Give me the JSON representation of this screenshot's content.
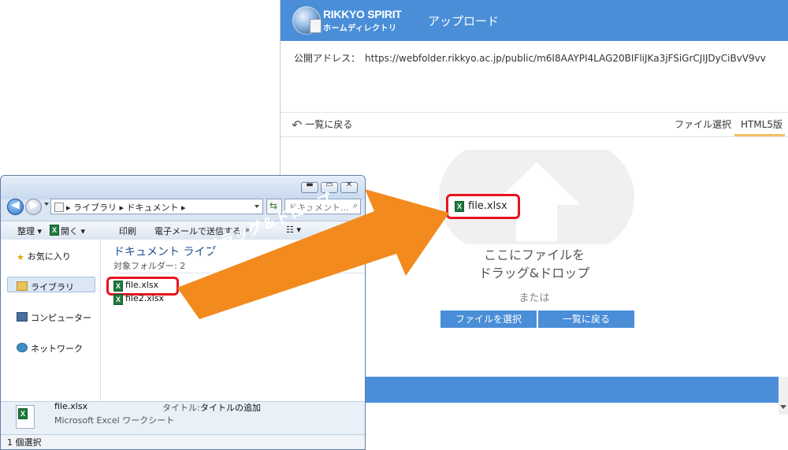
{
  "browser": {
    "logo_title": "RIKKYO SPIRIT",
    "logo_subtitle": "ホームディレクトリ",
    "page_heading": "アップロード",
    "public_address_label": "公開アドレス：",
    "public_address_url": "https://webfolder.rikkyo.ac.jp/public/m6I8AAYPI4LAG20BIFliJKa3jFSiGrCJIJDyCiBvV9vv",
    "back_link": "一覧に戻る",
    "tabs": [
      {
        "label": "ファイル選択",
        "active": false
      },
      {
        "label": "HTML5版",
        "active": true
      }
    ],
    "dropzone_line1": "ここにファイルを",
    "dropzone_line2": "ドラッグ&ドロップ",
    "or_text": "または",
    "select_button": "ファイルを選択",
    "back_button": "一覧に戻る",
    "dropped_file": "file.xlsx",
    "accent_color": "#4a8ed8",
    "tab_active_color": "#f2c266"
  },
  "explorer": {
    "address_path": "▸ ライブラリ ▸ ドキュメント ▸",
    "search_placeholder": "ドキュメント...",
    "toolbar": {
      "organize": "整理 ▾",
      "open": "開く ▾",
      "print": "印刷",
      "email": "電子メールで送信する",
      "more": "»"
    },
    "sidebar": [
      {
        "label": "お気に入り",
        "icon": "star-icon"
      },
      {
        "label": "ライブラリ",
        "icon": "library-icon",
        "selected": true
      },
      {
        "label": "コンピューター",
        "icon": "computer-icon"
      },
      {
        "label": "ネットワーク",
        "icon": "network-icon"
      }
    ],
    "content_title": "ドキュメント ライブ",
    "content_subtitle": "対象フォルダー: 2",
    "files": [
      "file.xlsx",
      "file2.xlsx"
    ],
    "details": {
      "name": "file.xlsx",
      "type": "Microsoft Excel ワークシート",
      "title_label": "タイトル:",
      "title_value": "タイトルの追加"
    },
    "status": "1 個選択"
  },
  "annotation": {
    "drag_label": "ドラッグ＆ドロップ",
    "arrow_color": "#f28a1e",
    "highlight_color": "#e8141e"
  }
}
